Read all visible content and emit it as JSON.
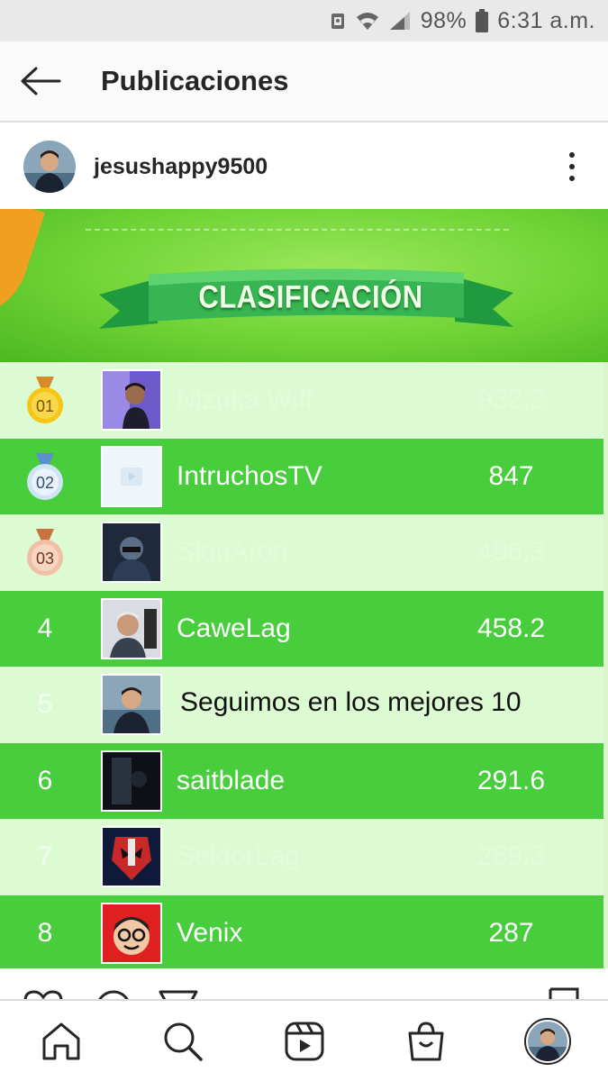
{
  "status_bar": {
    "battery_percent": "98%",
    "time": "6:31 a.m.",
    "icons": [
      "notification-icon",
      "wifi-icon",
      "signal-icon",
      "battery-icon"
    ]
  },
  "header": {
    "back_icon": "arrow-left-icon",
    "title": "Publicaciones"
  },
  "post": {
    "username": "jesushappy9500",
    "more_icon": "vertical-dots-icon"
  },
  "leaderboard": {
    "title": "CLASIFICACIÓN",
    "overlay_caption": "Seguimos en los mejores 10",
    "rows": [
      {
        "rank": "01",
        "name": "Nizuka Wiff",
        "score": "932.2",
        "medal": "gold"
      },
      {
        "rank": "02",
        "name": "IntruchosTV",
        "score": "847",
        "medal": "silver"
      },
      {
        "rank": "03",
        "name": "SionAron",
        "score": "496.3",
        "medal": "bronze"
      },
      {
        "rank": "4",
        "name": "CaweLag",
        "score": "458.2"
      },
      {
        "rank": "5",
        "name": "",
        "score": ""
      },
      {
        "rank": "6",
        "name": "saitblade",
        "score": "291.6"
      },
      {
        "rank": "7",
        "name": "SektorLag",
        "score": "289.3"
      },
      {
        "rank": "8",
        "name": "Venix",
        "score": "287"
      }
    ]
  },
  "colors": {
    "row_dark": "#48cd3d",
    "row_light": "#ddfbd3",
    "banner_green": "#6fd336",
    "ribbon_green": "#2fa84a",
    "gold": "#f5c518",
    "silver": "#cfe3f5",
    "bronze": "#f1bfa6"
  },
  "bottom_nav": {
    "items": [
      "home-icon",
      "search-icon",
      "reels-icon",
      "shop-icon",
      "profile-avatar"
    ]
  }
}
